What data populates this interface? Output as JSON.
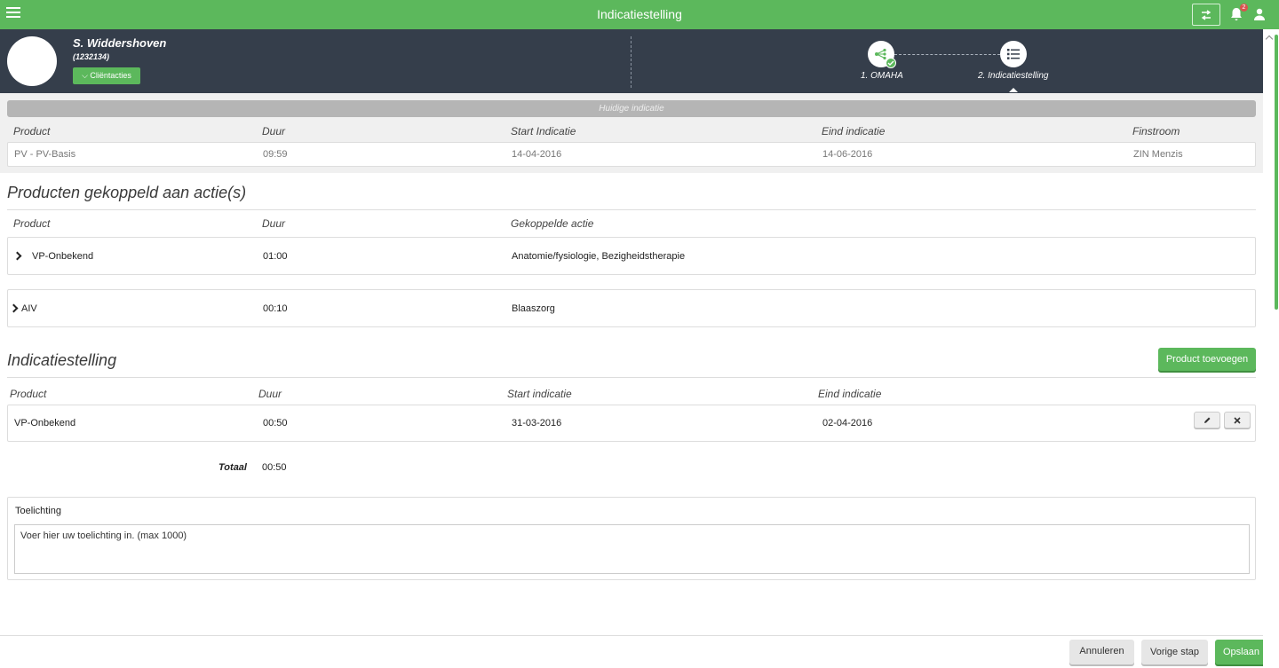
{
  "topbar": {
    "title": "Indicatiestelling",
    "notification_count": "2",
    "icons": {
      "menu": "hamburger-icon",
      "swap": "swap-icon",
      "bell": "bell-icon",
      "user": "user-icon"
    }
  },
  "client": {
    "name": "S. Widdershoven",
    "id": "(1232134)",
    "actions_label": "Cliëntacties"
  },
  "steps": [
    {
      "label": "1. OMAHA",
      "completed": true
    },
    {
      "label": "2. Indicatiestelling",
      "active": true
    }
  ],
  "current_indication": {
    "banner": "Huidige indicatie",
    "headers": {
      "product": "Product",
      "duration": "Duur",
      "start": "Start Indicatie",
      "end": "Eind indicatie",
      "finance": "Finstroom"
    },
    "row": {
      "product": "PV - PV-Basis",
      "duration": "09:59",
      "start": "14-04-2016",
      "end": "14-06-2016",
      "finance": "ZIN Menzis"
    }
  },
  "linked_products": {
    "title": "Producten gekoppeld aan actie(s)",
    "headers": {
      "product": "Product",
      "duration": "Duur",
      "action": "Gekoppelde actie"
    },
    "rows": [
      {
        "product": "VP-Onbekend",
        "duration": "01:00",
        "action": "Anatomie/fysiologie, Bezigheidstherapie"
      },
      {
        "product": "AIV",
        "duration": "00:10",
        "action": "Blaaszorg"
      }
    ]
  },
  "indication": {
    "title": "Indicatiestelling",
    "add_button": "Product toevoegen",
    "headers": {
      "product": "Product",
      "duration": "Duur",
      "start": "Start indicatie",
      "end": "Eind indicatie"
    },
    "rows": [
      {
        "product": "VP-Onbekend",
        "duration": "00:50",
        "start": "31-03-2016",
        "end": "02-04-2016"
      }
    ],
    "total_label": "Totaal",
    "total_value": "00:50"
  },
  "explanation": {
    "label": "Toelichting",
    "placeholder": "Voer hier uw toelichting in. (max 1000)"
  },
  "footer": {
    "cancel": "Annuleren",
    "previous": "Vorige stap",
    "save": "Opslaan"
  },
  "colors": {
    "accent": "#5cb85c",
    "header_bg": "#353e4b",
    "danger": "#d9534f"
  }
}
